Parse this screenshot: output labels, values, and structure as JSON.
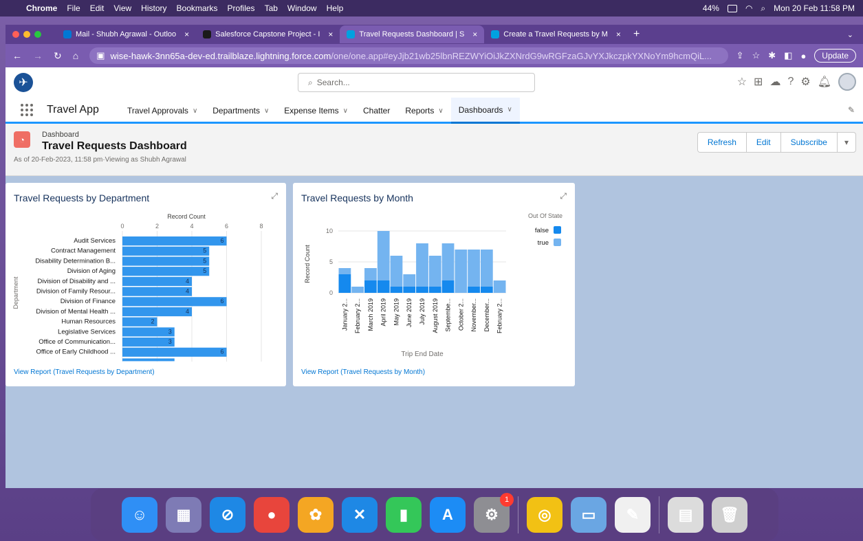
{
  "menubar": {
    "app": "Chrome",
    "items": [
      "File",
      "Edit",
      "View",
      "History",
      "Bookmarks",
      "Profiles",
      "Tab",
      "Window",
      "Help"
    ],
    "battery": "44%",
    "datetime": "Mon 20 Feb  11:58 PM"
  },
  "tabs": [
    {
      "label": "Mail - Shubh Agrawal - Outloo",
      "fav": "#0078d4",
      "active": false
    },
    {
      "label": "Salesforce Capstone Project - I",
      "fav": "#1a1a1a",
      "active": false
    },
    {
      "label": "Travel Requests Dashboard | S",
      "fav": "#00a1e0",
      "active": true
    },
    {
      "label": "Create a Travel Requests by M",
      "fav": "#00a1e0",
      "active": false
    }
  ],
  "address": {
    "host": "wise-hawk-3nn65a-dev-ed.trailblaze.lightning.force.com",
    "path": "/one/one.app#eyJjb21wb25lbnREZWYiOiJkZXNrdG9wRGFzaGJvYXJkczpkYXNoYm9hcmQiL...",
    "update_label": "Update"
  },
  "sf": {
    "search_placeholder": "Search...",
    "app_name": "Travel App",
    "nav": [
      {
        "label": "Travel Approvals",
        "chev": true
      },
      {
        "label": "Departments",
        "chev": true
      },
      {
        "label": "Expense Items",
        "chev": true
      },
      {
        "label": "Chatter",
        "chev": false
      },
      {
        "label": "Reports",
        "chev": true
      },
      {
        "label": "Dashboards",
        "chev": true,
        "active": true
      }
    ]
  },
  "page": {
    "kicker": "Dashboard",
    "title": "Travel Requests Dashboard",
    "as_of": "As of 20-Feb-2023, 11:58 pm·Viewing as Shubh Agrawal",
    "buttons": {
      "refresh": "Refresh",
      "edit": "Edit",
      "subscribe": "Subscribe"
    }
  },
  "card1": {
    "title": "Travel Requests by Department",
    "link": "View Report (Travel Requests by Department)"
  },
  "card2": {
    "title": "Travel Requests by Month",
    "link": "View Report (Travel Requests by Month)"
  },
  "chart_data": [
    {
      "type": "bar",
      "orientation": "horizontal",
      "title": "Travel Requests by Department",
      "xlabel": "Record Count",
      "ylabel": "Department",
      "xlim": [
        0,
        8
      ],
      "xticks": [
        0,
        2,
        4,
        6,
        8
      ],
      "categories": [
        "Audit Services",
        "Contract Management",
        "Disability Determination B...",
        "Division of Aging",
        "Division of Disability and ...",
        "Division of Family Resour...",
        "Division of Finance",
        "Division of Mental Health ...",
        "Human Resources",
        "Legislative Services",
        "Office of Communication...",
        "Office of Early Childhood ..."
      ],
      "values": [
        6,
        5,
        5,
        5,
        4,
        4,
        6,
        4,
        2,
        3,
        3,
        6
      ],
      "color": "#3296ed"
    },
    {
      "type": "bar",
      "stacked": true,
      "title": "Travel Requests by Month",
      "xlabel": "Trip End Date",
      "ylabel": "Record Count",
      "ylim": [
        0,
        10
      ],
      "yticks": [
        0,
        5,
        10
      ],
      "legend_title": "Out Of State",
      "legend_position": "top-right",
      "categories": [
        "January 2...",
        "February 2...",
        "March 2019",
        "April 2019",
        "May 2019",
        "June 2019",
        "July 2019",
        "August 2019",
        "Septembe...",
        "October 2...",
        "November...",
        "December...",
        "February 2..."
      ],
      "series": [
        {
          "name": "false",
          "color": "#1589ee",
          "values": [
            3,
            0,
            2,
            2,
            1,
            1,
            1,
            1,
            2,
            0,
            1,
            1,
            0
          ]
        },
        {
          "name": "true",
          "color": "#74b4f0",
          "values": [
            1,
            1,
            2,
            8,
            5,
            2,
            7,
            5,
            6,
            7,
            6,
            6,
            2
          ]
        }
      ]
    }
  ],
  "dock": [
    {
      "name": "finder",
      "color": "#2f8ff5",
      "glyph": "☺"
    },
    {
      "name": "launchpad",
      "color": "#7e7bb5",
      "glyph": "▦"
    },
    {
      "name": "safari",
      "color": "#1e88e5",
      "glyph": "⊘"
    },
    {
      "name": "chrome",
      "color": "#e8453c",
      "glyph": "●"
    },
    {
      "name": "photos",
      "color": "#f4a623",
      "glyph": "✿"
    },
    {
      "name": "vscode",
      "color": "#1e88e5",
      "glyph": "✕"
    },
    {
      "name": "numbers",
      "color": "#34c759",
      "glyph": "▮"
    },
    {
      "name": "appstore",
      "color": "#1c8cf5",
      "glyph": "A"
    },
    {
      "name": "settings",
      "color": "#8e8e93",
      "glyph": "⚙",
      "badge": "1"
    },
    {
      "name": "openai",
      "color": "#f2c114",
      "glyph": "◎"
    },
    {
      "name": "preview",
      "color": "#6aa6e3",
      "glyph": "▭"
    },
    {
      "name": "textedit",
      "color": "#f0f0f0",
      "glyph": "✎"
    },
    {
      "name": "documents",
      "color": "#dcdcdc",
      "glyph": "▤"
    },
    {
      "name": "trash",
      "color": "#cfcfcf",
      "glyph": "🗑"
    }
  ]
}
